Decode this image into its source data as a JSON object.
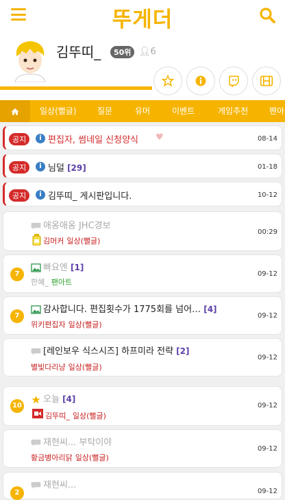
{
  "app": {
    "logo": "뚜게더"
  },
  "profile": {
    "name": "김뚜띠_",
    "rank": "50위",
    "followers": "6"
  },
  "tabs": [
    "일상(뻘글)",
    "질문",
    "유머",
    "이벤트",
    "게임추천",
    "팬아"
  ],
  "notices": [
    {
      "badge": "공지",
      "title": "편집자, 썸네일 신청양식",
      "date": "08-14",
      "color": "#d42a2a"
    },
    {
      "badge": "공지",
      "title": "님덜",
      "count": "[29]",
      "date": "01-18",
      "color": "#222"
    },
    {
      "badge": "공지",
      "title": "김뚜띠_ 게시판입니다.",
      "date": "10-12",
      "color": "#222"
    }
  ],
  "posts": [
    {
      "title": "애옹애옹 JHC경보",
      "author": "김머커",
      "category": "일상(뻘글)",
      "date": "00:29",
      "level": "",
      "icon": "chat-icon",
      "gray": true
    },
    {
      "title": "빠요엔",
      "count": "[1]",
      "author": "한혜_",
      "category": "팬아트",
      "date": "09-12",
      "level": "7",
      "icon": "image-icon",
      "gray": true
    },
    {
      "title": "감사합니다. 편집횟수가 1775회를 넘어…",
      "count": "[4]",
      "author": "위키편집자",
      "category": "일상(뻘글)",
      "date": "09-12",
      "level": "7",
      "icon": "image-icon",
      "gray": false
    },
    {
      "title": "[레인보우 식스시즈] 하프미라 전략",
      "count": "[2]",
      "author": "별빛다리냥",
      "category": "일상(뻘글)",
      "date": "09-12",
      "level": "",
      "icon": "chat-icon",
      "gray": false
    },
    {
      "title": "오늘",
      "count": "[4]",
      "author": "김뚜띠_",
      "category": "일상(뻘글)",
      "date": "09-12",
      "level": "10",
      "icon": "star-icon",
      "gray": true
    },
    {
      "title": "재현씨... 부탁이야",
      "author": "황금병아리닭",
      "category": "일상(뻘글)",
      "date": "09-12",
      "level": "",
      "icon": "chat-icon",
      "gray": true
    },
    {
      "title": "재현씨...",
      "author": "",
      "category": "",
      "date": "09-12",
      "level": "2",
      "icon": "chat-icon",
      "gray": true
    }
  ],
  "colors": {
    "accent": "#f6b400",
    "notice": "#d42a2a"
  }
}
